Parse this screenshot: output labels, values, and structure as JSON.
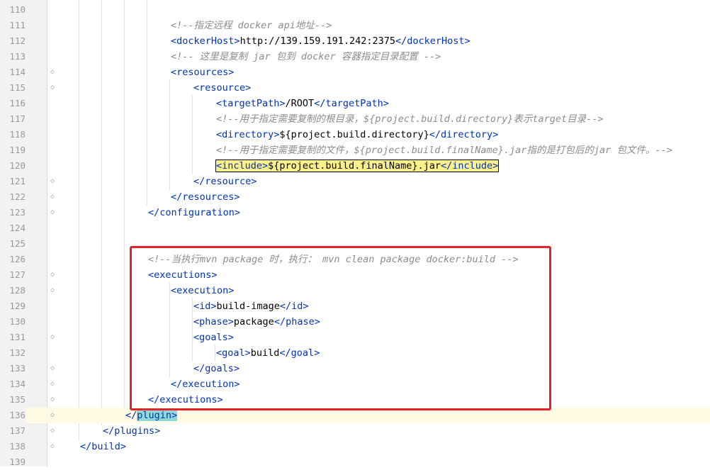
{
  "editor": {
    "lines": [
      {
        "num": "110",
        "fold": false,
        "indent": 0,
        "parts": []
      },
      {
        "num": "111",
        "fold": false,
        "indent": 7,
        "parts": [
          {
            "t": "<!--指定远程 docker api地址-->",
            "c": "cmt"
          }
        ]
      },
      {
        "num": "112",
        "fold": false,
        "indent": 7,
        "parts": [
          {
            "t": "<",
            "c": "tag"
          },
          {
            "t": "dockerHost",
            "c": "tag"
          },
          {
            "t": ">",
            "c": "tag"
          },
          {
            "t": "http://139.159.191.242:2375",
            "c": ""
          },
          {
            "t": "</",
            "c": "tag"
          },
          {
            "t": "dockerHost",
            "c": "tag"
          },
          {
            "t": ">",
            "c": "tag"
          }
        ]
      },
      {
        "num": "113",
        "fold": false,
        "indent": 7,
        "parts": [
          {
            "t": "<!-- 这里是复制 jar 包到 docker 容器指定目录配置 -->",
            "c": "cmt"
          }
        ]
      },
      {
        "num": "114",
        "fold": true,
        "indent": 7,
        "parts": [
          {
            "t": "<resources>",
            "c": "tag"
          }
        ]
      },
      {
        "num": "115",
        "fold": true,
        "indent": 8,
        "parts": [
          {
            "t": "<resource>",
            "c": "tag"
          }
        ]
      },
      {
        "num": "116",
        "fold": false,
        "indent": 9,
        "parts": [
          {
            "t": "<targetPath>",
            "c": "tag"
          },
          {
            "t": "/ROOT",
            "c": ""
          },
          {
            "t": "</targetPath>",
            "c": "tag"
          }
        ]
      },
      {
        "num": "117",
        "fold": false,
        "indent": 9,
        "parts": [
          {
            "t": "<!--用于指定需要复制的根目录，${project.build.directory}表示target目录-->",
            "c": "cmt"
          }
        ]
      },
      {
        "num": "118",
        "fold": false,
        "indent": 9,
        "parts": [
          {
            "t": "<directory>",
            "c": "tag"
          },
          {
            "t": "${project.build.directory}",
            "c": ""
          },
          {
            "t": "</directory>",
            "c": "tag"
          }
        ]
      },
      {
        "num": "119",
        "fold": false,
        "indent": 9,
        "parts": [
          {
            "t": "<!--用于指定需要复制的文件，${project.build.finalName}.jar指的是打包后的jar 包文件。-->",
            "c": "cmt"
          }
        ]
      },
      {
        "num": "120",
        "fold": false,
        "indent": 9,
        "hl": "include",
        "parts": [
          {
            "t": "<include>",
            "c": "tag"
          },
          {
            "t": "${project.build.finalName}.jar",
            "c": ""
          },
          {
            "t": "</include>",
            "c": "tag"
          }
        ]
      },
      {
        "num": "121",
        "fold": true,
        "indent": 8,
        "parts": [
          {
            "t": "</resource>",
            "c": "tag"
          }
        ]
      },
      {
        "num": "122",
        "fold": true,
        "indent": 7,
        "parts": [
          {
            "t": "</resources>",
            "c": "tag"
          }
        ]
      },
      {
        "num": "123",
        "fold": true,
        "indent": 6,
        "parts": [
          {
            "t": "</configuration>",
            "c": "tag"
          }
        ]
      },
      {
        "num": "124",
        "fold": false,
        "indent": 0,
        "parts": []
      },
      {
        "num": "125",
        "fold": false,
        "indent": 0,
        "parts": []
      },
      {
        "num": "126",
        "fold": false,
        "indent": 6,
        "parts": [
          {
            "t": "<!--当执行mvn package 时，执行： mvn clean package docker:build -->",
            "c": "cmt"
          }
        ]
      },
      {
        "num": "127",
        "fold": true,
        "indent": 6,
        "parts": [
          {
            "t": "<executions>",
            "c": "tag"
          }
        ]
      },
      {
        "num": "128",
        "fold": true,
        "indent": 7,
        "parts": [
          {
            "t": "<execution>",
            "c": "tag"
          }
        ]
      },
      {
        "num": "129",
        "fold": false,
        "indent": 8,
        "parts": [
          {
            "t": "<id>",
            "c": "tag"
          },
          {
            "t": "build-image",
            "c": ""
          },
          {
            "t": "</id>",
            "c": "tag"
          }
        ]
      },
      {
        "num": "130",
        "fold": false,
        "indent": 8,
        "parts": [
          {
            "t": "<phase>",
            "c": "tag"
          },
          {
            "t": "package",
            "c": ""
          },
          {
            "t": "</phase>",
            "c": "tag"
          }
        ]
      },
      {
        "num": "131",
        "fold": true,
        "indent": 8,
        "parts": [
          {
            "t": "<goals>",
            "c": "tag"
          }
        ]
      },
      {
        "num": "132",
        "fold": false,
        "indent": 9,
        "parts": [
          {
            "t": "<goal>",
            "c": "tag"
          },
          {
            "t": "build",
            "c": ""
          },
          {
            "t": "</goal>",
            "c": "tag"
          }
        ]
      },
      {
        "num": "133",
        "fold": true,
        "indent": 8,
        "parts": [
          {
            "t": "</goals>",
            "c": "tag"
          }
        ]
      },
      {
        "num": "134",
        "fold": true,
        "indent": 7,
        "parts": [
          {
            "t": "</execution>",
            "c": "tag"
          }
        ]
      },
      {
        "num": "135",
        "fold": true,
        "indent": 6,
        "parts": [
          {
            "t": "</executions>",
            "c": "tag"
          }
        ]
      },
      {
        "num": "136",
        "fold": true,
        "indent": 5,
        "current": true,
        "hl": "plugin",
        "parts": [
          {
            "t": "</plugin>",
            "c": "tag"
          }
        ]
      },
      {
        "num": "137",
        "fold": true,
        "indent": 4,
        "parts": [
          {
            "t": "</plugins>",
            "c": "tag"
          }
        ]
      },
      {
        "num": "138",
        "fold": true,
        "indent": 3,
        "parts": [
          {
            "t": "</build>",
            "c": "tag"
          }
        ]
      },
      {
        "num": "139",
        "fold": false,
        "indent": 0,
        "parts": []
      }
    ]
  },
  "annotation": {
    "color": "#e8222a"
  },
  "colors": {
    "tag": "#0033b3",
    "comment": "#8c8c8c",
    "text": "#000000",
    "current_line": "#fffae3"
  }
}
